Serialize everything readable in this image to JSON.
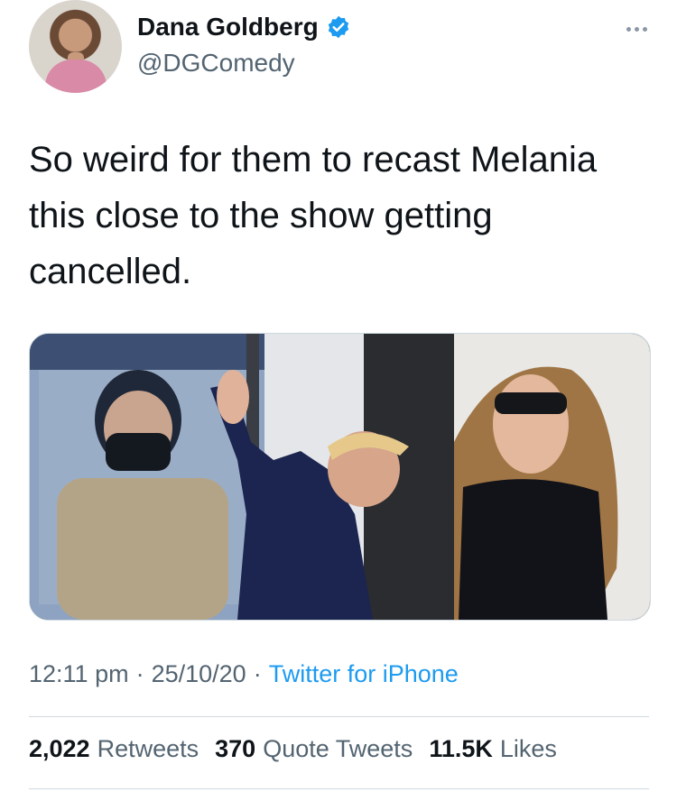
{
  "user": {
    "display_name": "Dana Goldberg",
    "handle": "@DGComedy",
    "verified": true
  },
  "tweet": {
    "text": "So weird for them to recast Melania\nthis close to the show getting\ncancelled."
  },
  "meta": {
    "time": "12:11 pm",
    "separator1": "·",
    "date": "25/10/20",
    "separator2": "·",
    "source": "Twitter for iPhone"
  },
  "stats": [
    {
      "count": "2,022",
      "label": "Retweets"
    },
    {
      "count": "370",
      "label": "Quote Tweets"
    },
    {
      "count": "11.5K",
      "label": "Likes"
    }
  ],
  "icons": {
    "verified": "verified-badge-icon",
    "more": "more-options-icon"
  },
  "colors": {
    "accent": "#1d9bf0",
    "secondary_text": "#536471",
    "primary_text": "#0f1419"
  }
}
